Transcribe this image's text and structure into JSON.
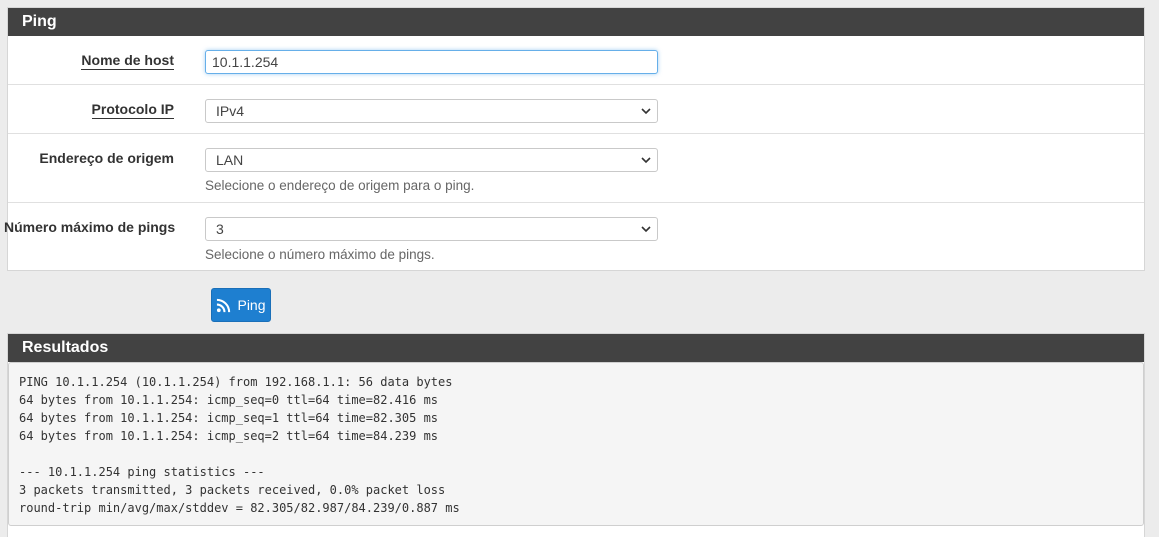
{
  "ping_panel": {
    "title": "Ping",
    "rows": [
      {
        "label": "Nome de host",
        "value": "10.1.1.254"
      },
      {
        "label": "Protocolo IP",
        "value": "IPv4"
      },
      {
        "label": "Endereço de origem",
        "value": "LAN",
        "help": "Selecione o endereço de origem para o ping."
      },
      {
        "label": "Número máximo de pings",
        "value": "3",
        "help": "Selecione o número máximo de pings."
      }
    ]
  },
  "button": {
    "label": "Ping",
    "icon": "rss-icon",
    "color": "#1e7fd0"
  },
  "results_panel": {
    "title": "Resultados",
    "lines": [
      "PING 10.1.1.254 (10.1.1.254) from 192.168.1.1: 56 data bytes",
      "64 bytes from 10.1.1.254: icmp_seq=0 ttl=64 time=82.416 ms",
      "64 bytes from 10.1.1.254: icmp_seq=1 ttl=64 time=82.305 ms",
      "64 bytes from 10.1.1.254: icmp_seq=2 ttl=64 time=84.239 ms",
      "",
      "--- 10.1.1.254 ping statistics ---",
      "3 packets transmitted, 3 packets received, 0.0% packet loss",
      "round-trip min/avg/max/stddev = 82.305/82.987/84.239/0.887 ms"
    ]
  }
}
